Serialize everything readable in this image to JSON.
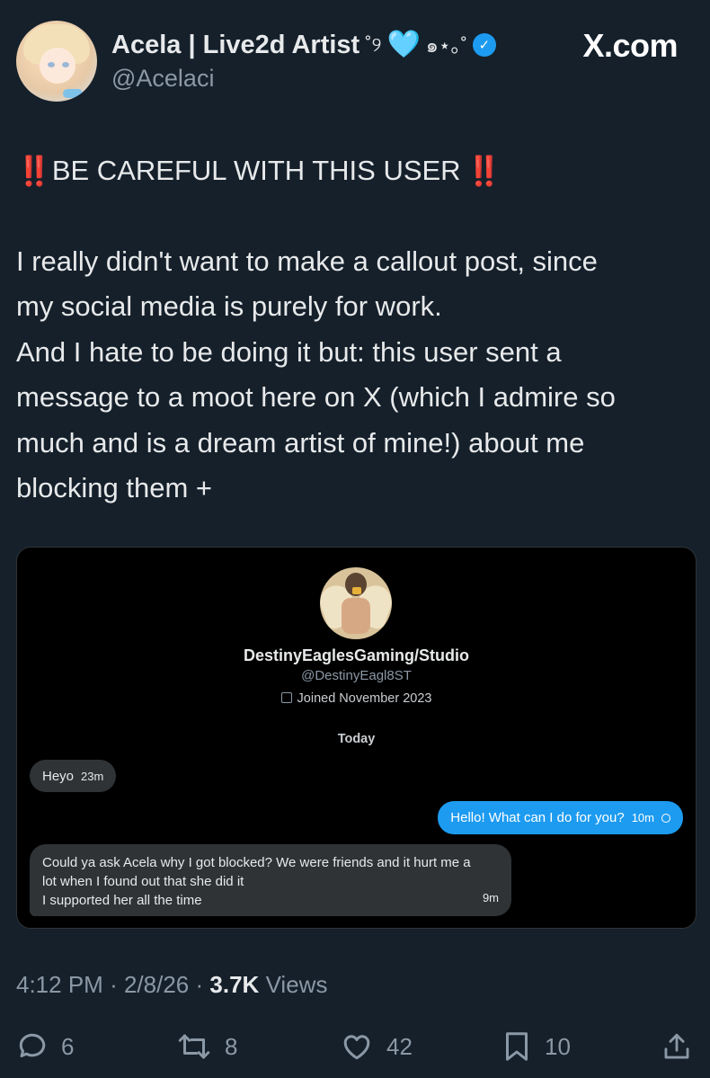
{
  "author": {
    "display_name": "Acela | Live2d Artist",
    "decorations_left": "˚୨",
    "heart": "🩵",
    "decorations_right": "๑⋆｡˚",
    "handle": "@Acelaci",
    "verified": true
  },
  "brand": "X.com",
  "tweet": {
    "warning": "BE CAREFUL WITH THIS USER",
    "warning_emoji": "‼️",
    "body_lines": [
      "I really didn't want to make a callout post, since",
      "my social media is purely for work.",
      "And I hate to be doing it but: this user sent a",
      "message to a moot here on X (which I admire so",
      "much and is a dream artist of mine!) about me",
      "blocking them +"
    ]
  },
  "dm_screenshot": {
    "profile_name": "DestinyEaglesGaming/Studio",
    "profile_handle": "@DestinyEagl8ST",
    "joined": "Joined November 2023",
    "day_label": "Today",
    "messages": [
      {
        "from": "them",
        "text": "Heyo",
        "time": "23m"
      },
      {
        "from": "me",
        "text": "Hello! What can I do for you?",
        "time": "10m"
      },
      {
        "from": "them",
        "lines": [
          "Could ya ask Acela why I got blocked? We were friends and it hurt me a",
          "lot when I found out that she did it",
          "I supported her all the time"
        ],
        "time": "9m"
      }
    ]
  },
  "meta": {
    "time": "4:12 PM",
    "separator": "·",
    "date": "2/8/26",
    "views_count": "3.7K",
    "views_label": "Views"
  },
  "actions": {
    "replies": "6",
    "reposts": "8",
    "likes": "42",
    "bookmarks": "10"
  },
  "colors": {
    "background": "#15202b",
    "accent": "#1d9bf0",
    "warning_red": "#f4212e",
    "muted": "#8b98a5"
  }
}
